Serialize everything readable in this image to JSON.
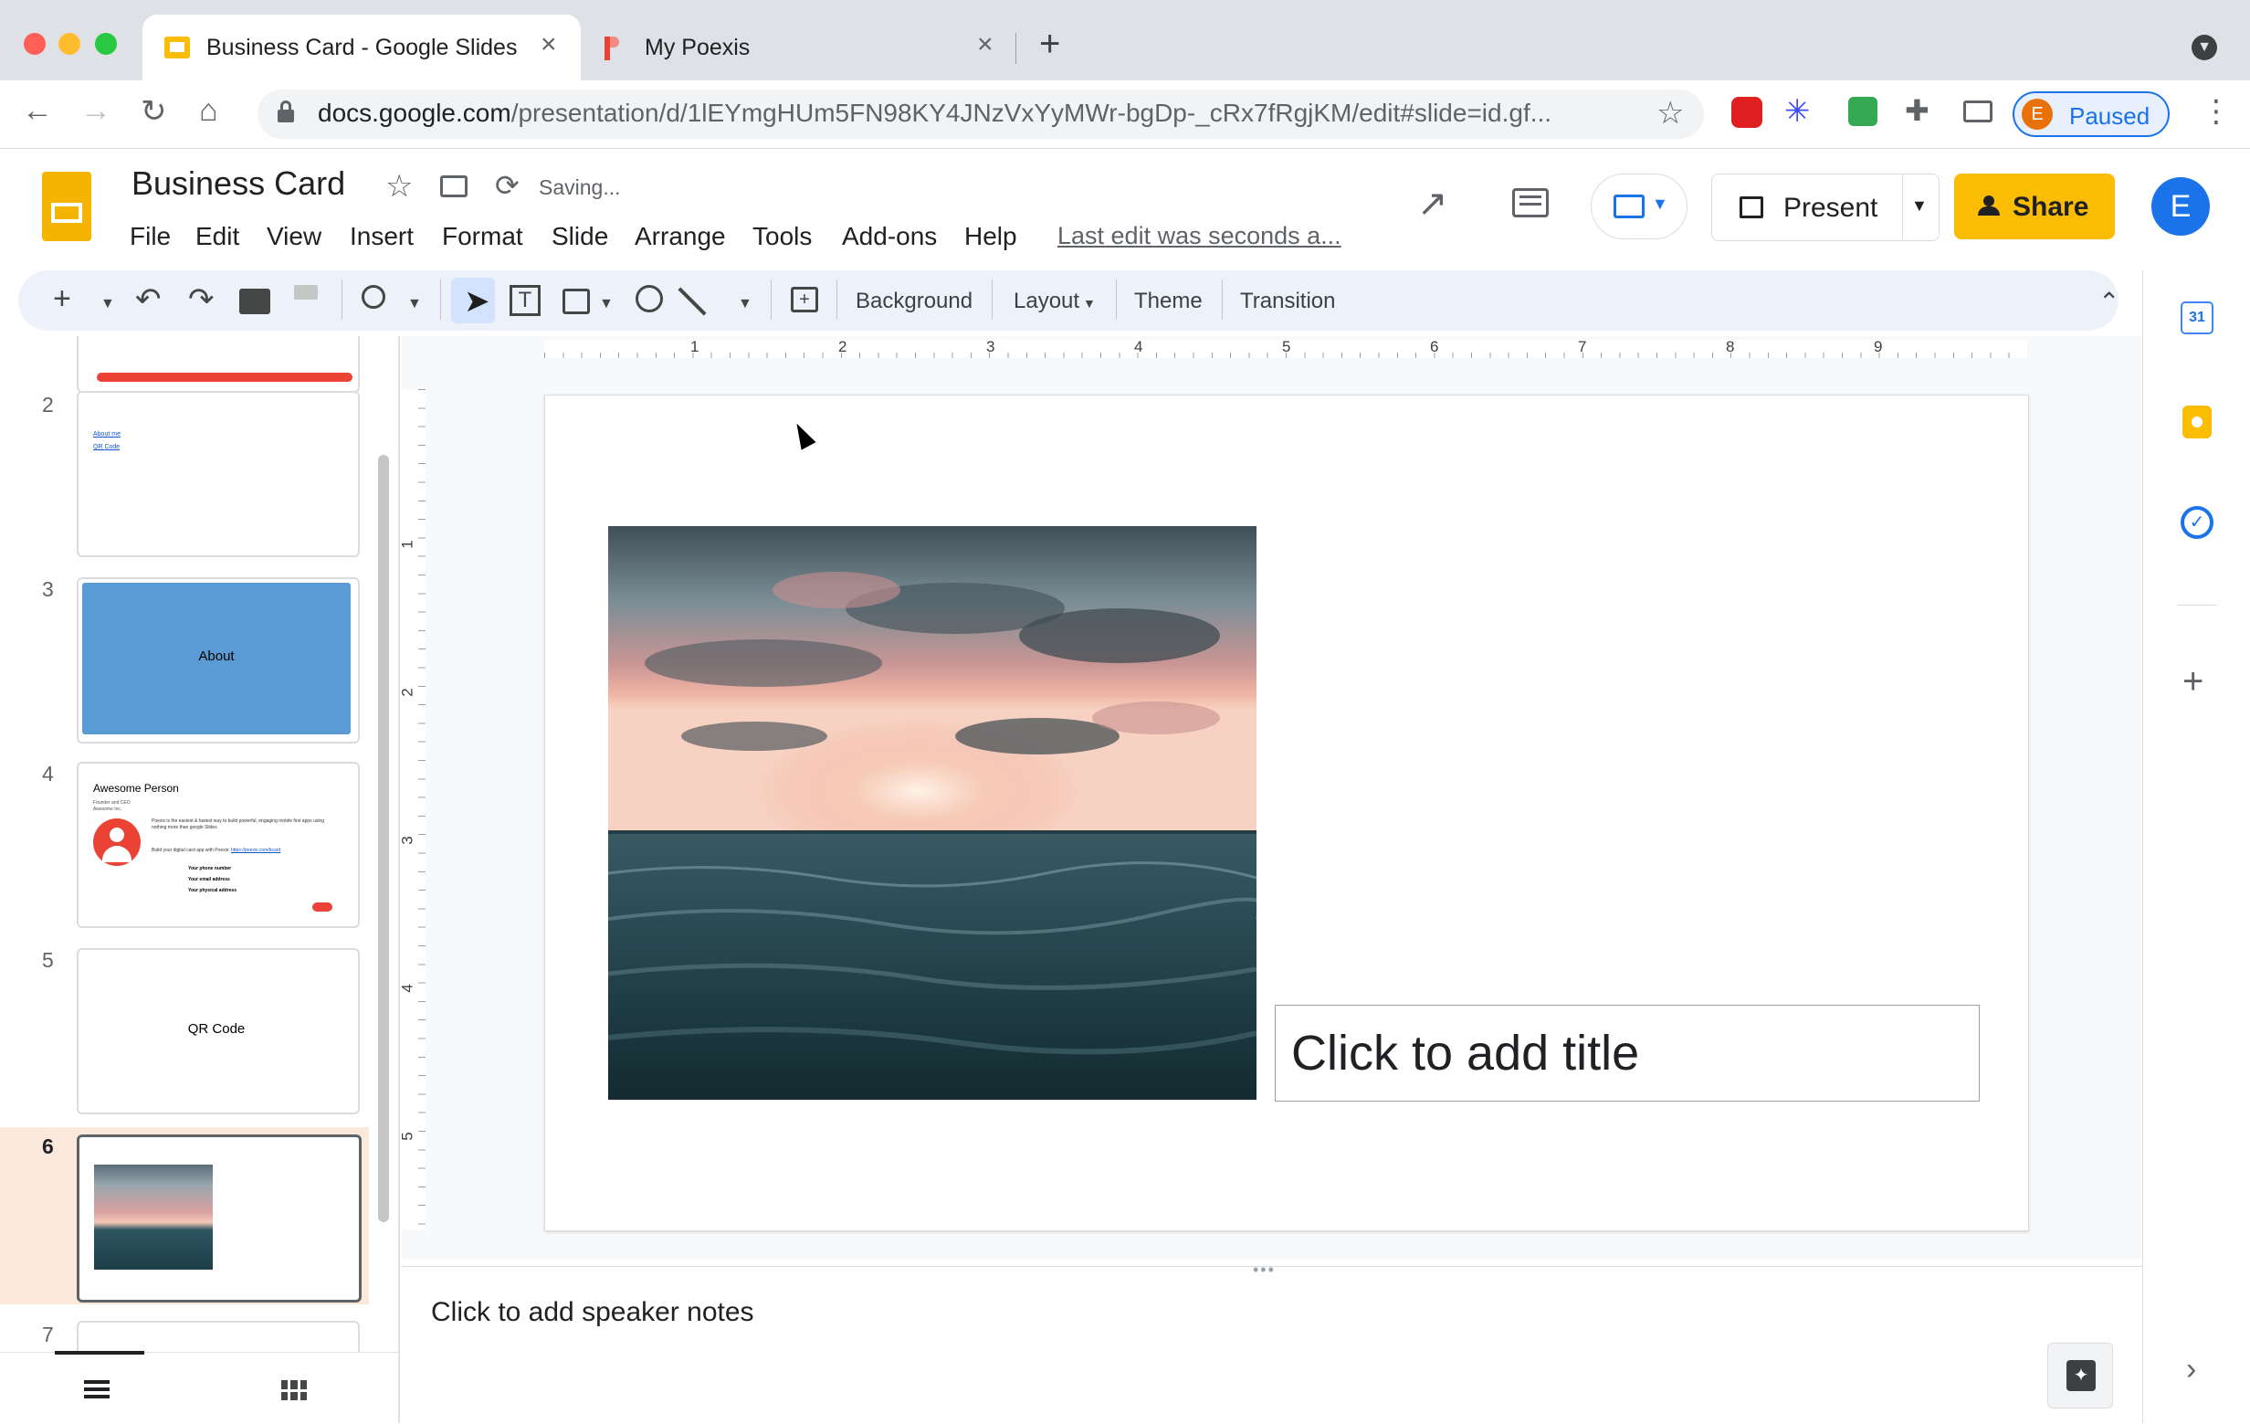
{
  "browser": {
    "tabs": [
      {
        "title": "Business Card - Google Slides",
        "active": true
      },
      {
        "title": "My Poexis",
        "active": false
      }
    ],
    "url_host": "docs.google.com",
    "url_path": "/presentation/d/1lEYmgHUm5FN98KY4JNzVxYyMWr-bgDp-_cRx7fRgjKM/edit#slide=id.gf...",
    "profile": {
      "initial": "E",
      "label": "Paused"
    }
  },
  "doc": {
    "title": "Business Card",
    "save_status": "Saving...",
    "menu": [
      "File",
      "Edit",
      "View",
      "Insert",
      "Format",
      "Slide",
      "Arrange",
      "Tools",
      "Add-ons",
      "Help"
    ],
    "last_edit": "Last edit was seconds a...",
    "present_label": "Present",
    "share_label": "Share",
    "user_initial": "E"
  },
  "toolbar": {
    "background": "Background",
    "layout": "Layout",
    "theme": "Theme",
    "transition": "Transition"
  },
  "filmstrip": {
    "slides": [
      {
        "number": "2",
        "links": [
          "About me",
          "QR Code"
        ]
      },
      {
        "number": "3",
        "text": "About",
        "fill": "#5b9bd5"
      },
      {
        "number": "4",
        "heading": "Awesome Person",
        "sub": "Founder and CEO",
        "sub2": "Awesome Inc.",
        "body": "Poexis is the easiest & fastest way to build powerful, engaging mobile first apps using nothing more than google Slides",
        "cta": "Build your digital card app with Poexis:",
        "cta_link": "https://poexis.com/bcard",
        "contacts": [
          "Your phone number",
          "Your email address",
          "Your physical address"
        ]
      },
      {
        "number": "5",
        "text": "QR Code"
      },
      {
        "number": "6",
        "selected": true
      },
      {
        "number": "7"
      }
    ]
  },
  "slide": {
    "title_placeholder": "Click to add title"
  },
  "ruler": {
    "h_marks": [
      "1",
      "2",
      "3",
      "4",
      "5",
      "6",
      "7",
      "8",
      "9"
    ],
    "v_marks": [
      "1",
      "2",
      "3",
      "4",
      "5"
    ]
  },
  "notes": {
    "placeholder": "Click to add speaker notes"
  },
  "colors": {
    "accent_yellow": "#fbbc04",
    "accent_blue": "#1a73e8",
    "selected_row": "#fbeadb"
  }
}
